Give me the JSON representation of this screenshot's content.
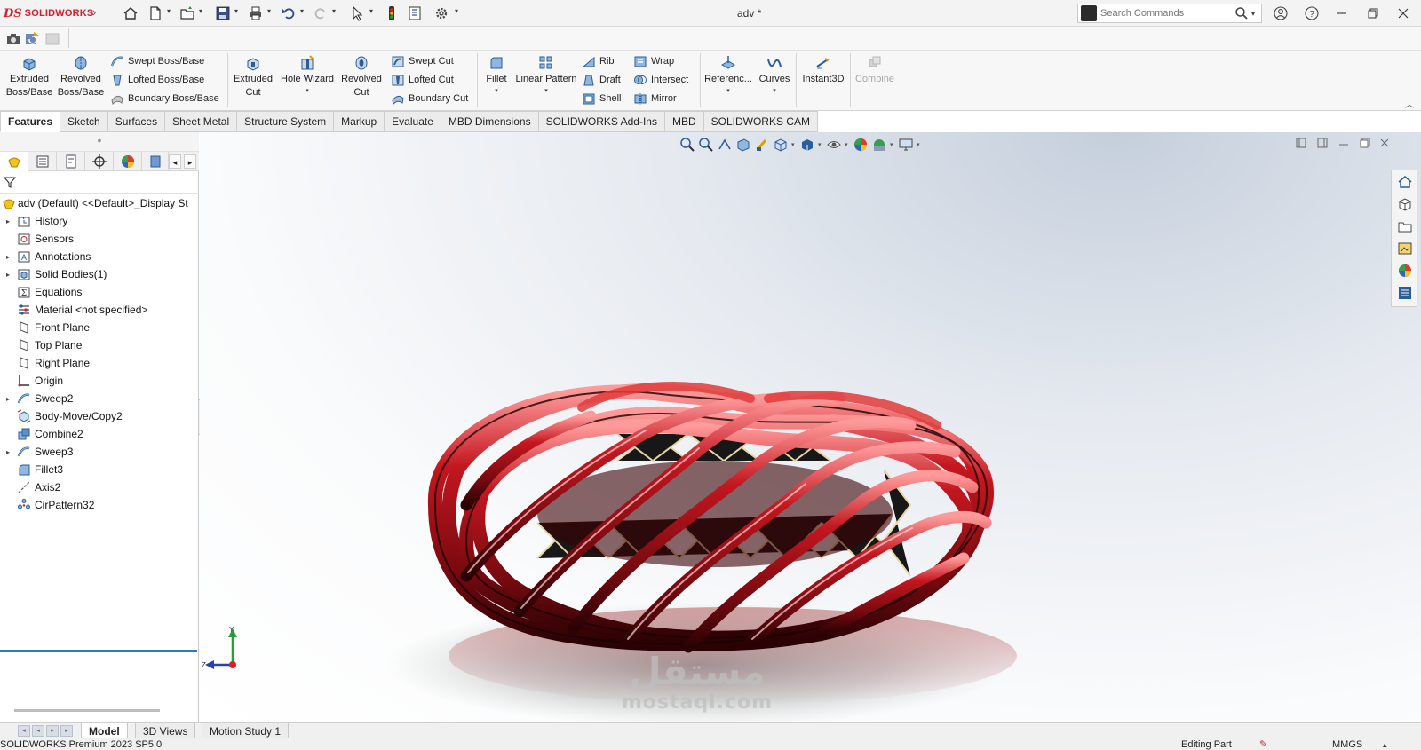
{
  "app": {
    "brand_symbol": "DS",
    "brand_name": "SOLIDWORKS",
    "document_title": "adv *"
  },
  "search": {
    "placeholder": "Search Commands"
  },
  "ribbon": {
    "extruded_boss": "Extruded\nBoss/Base",
    "revolved_boss": "Revolved\nBoss/Base",
    "swept_boss": "Swept Boss/Base",
    "lofted_boss": "Lofted Boss/Base",
    "boundary_boss": "Boundary Boss/Base",
    "extruded_cut": "Extruded\nCut",
    "hole_wizard": "Hole Wizard",
    "revolved_cut": "Revolved\nCut",
    "swept_cut": "Swept Cut",
    "lofted_cut": "Lofted Cut",
    "boundary_cut": "Boundary Cut",
    "fillet": "Fillet",
    "linear_pattern": "Linear Pattern",
    "rib": "Rib",
    "draft": "Draft",
    "shell": "Shell",
    "wrap": "Wrap",
    "intersect": "Intersect",
    "mirror": "Mirror",
    "reference": "Referenc...",
    "curves": "Curves",
    "instant3d": "Instant3D",
    "combine": "Combine"
  },
  "tabs": [
    {
      "label": "Features",
      "active": true
    },
    {
      "label": "Sketch"
    },
    {
      "label": "Surfaces"
    },
    {
      "label": "Sheet Metal"
    },
    {
      "label": "Structure System"
    },
    {
      "label": "Markup"
    },
    {
      "label": "Evaluate"
    },
    {
      "label": "MBD Dimensions"
    },
    {
      "label": "SOLIDWORKS Add-Ins"
    },
    {
      "label": "MBD"
    },
    {
      "label": "SOLIDWORKS CAM"
    }
  ],
  "tree": {
    "root": "adv (Default) <<Default>_Display St",
    "items": [
      {
        "label": "History",
        "icon": "history-folder-icon",
        "expandable": true
      },
      {
        "label": "Sensors",
        "icon": "sensors-icon",
        "expandable": false
      },
      {
        "label": "Annotations",
        "icon": "annotations-icon",
        "expandable": true
      },
      {
        "label": "Solid Bodies(1)",
        "icon": "solid-bodies-icon",
        "expandable": true
      },
      {
        "label": "Equations",
        "icon": "equations-icon",
        "expandable": false
      },
      {
        "label": "Material <not specified>",
        "icon": "material-icon",
        "expandable": false
      },
      {
        "label": "Front Plane",
        "icon": "plane-icon",
        "expandable": false
      },
      {
        "label": "Top Plane",
        "icon": "plane-icon",
        "expandable": false
      },
      {
        "label": "Right Plane",
        "icon": "plane-icon",
        "expandable": false
      },
      {
        "label": "Origin",
        "icon": "origin-icon",
        "expandable": false
      },
      {
        "label": "Sweep2",
        "icon": "sweep-icon",
        "expandable": true
      },
      {
        "label": "Body-Move/Copy2",
        "icon": "move-copy-icon",
        "expandable": false
      },
      {
        "label": "Combine2",
        "icon": "combine-icon",
        "expandable": false
      },
      {
        "label": "Sweep3",
        "icon": "sweep-icon",
        "expandable": true
      },
      {
        "label": "Fillet3",
        "icon": "fillet-icon",
        "expandable": false
      },
      {
        "label": "Axis2",
        "icon": "axis-icon",
        "expandable": false
      },
      {
        "label": "CirPattern32",
        "icon": "circular-pattern-icon",
        "expandable": false
      }
    ]
  },
  "viewport": {
    "triad": {
      "y": "Y",
      "z": "Z"
    },
    "watermark_arabic": "مستقل",
    "watermark_latin": "mostaql.com"
  },
  "bottom_tabs": [
    {
      "label": "Model",
      "active": true
    },
    {
      "label": "3D Views"
    },
    {
      "label": "Motion Study 1"
    }
  ],
  "status": {
    "product": "SOLIDWORKS Premium 2023 SP5.0",
    "mode": "Editing Part",
    "units": "MMGS"
  },
  "colors": {
    "accent_red": "#d21f2a",
    "model_red": "#b3121b",
    "rollback_bar": "#2b7bb9"
  }
}
